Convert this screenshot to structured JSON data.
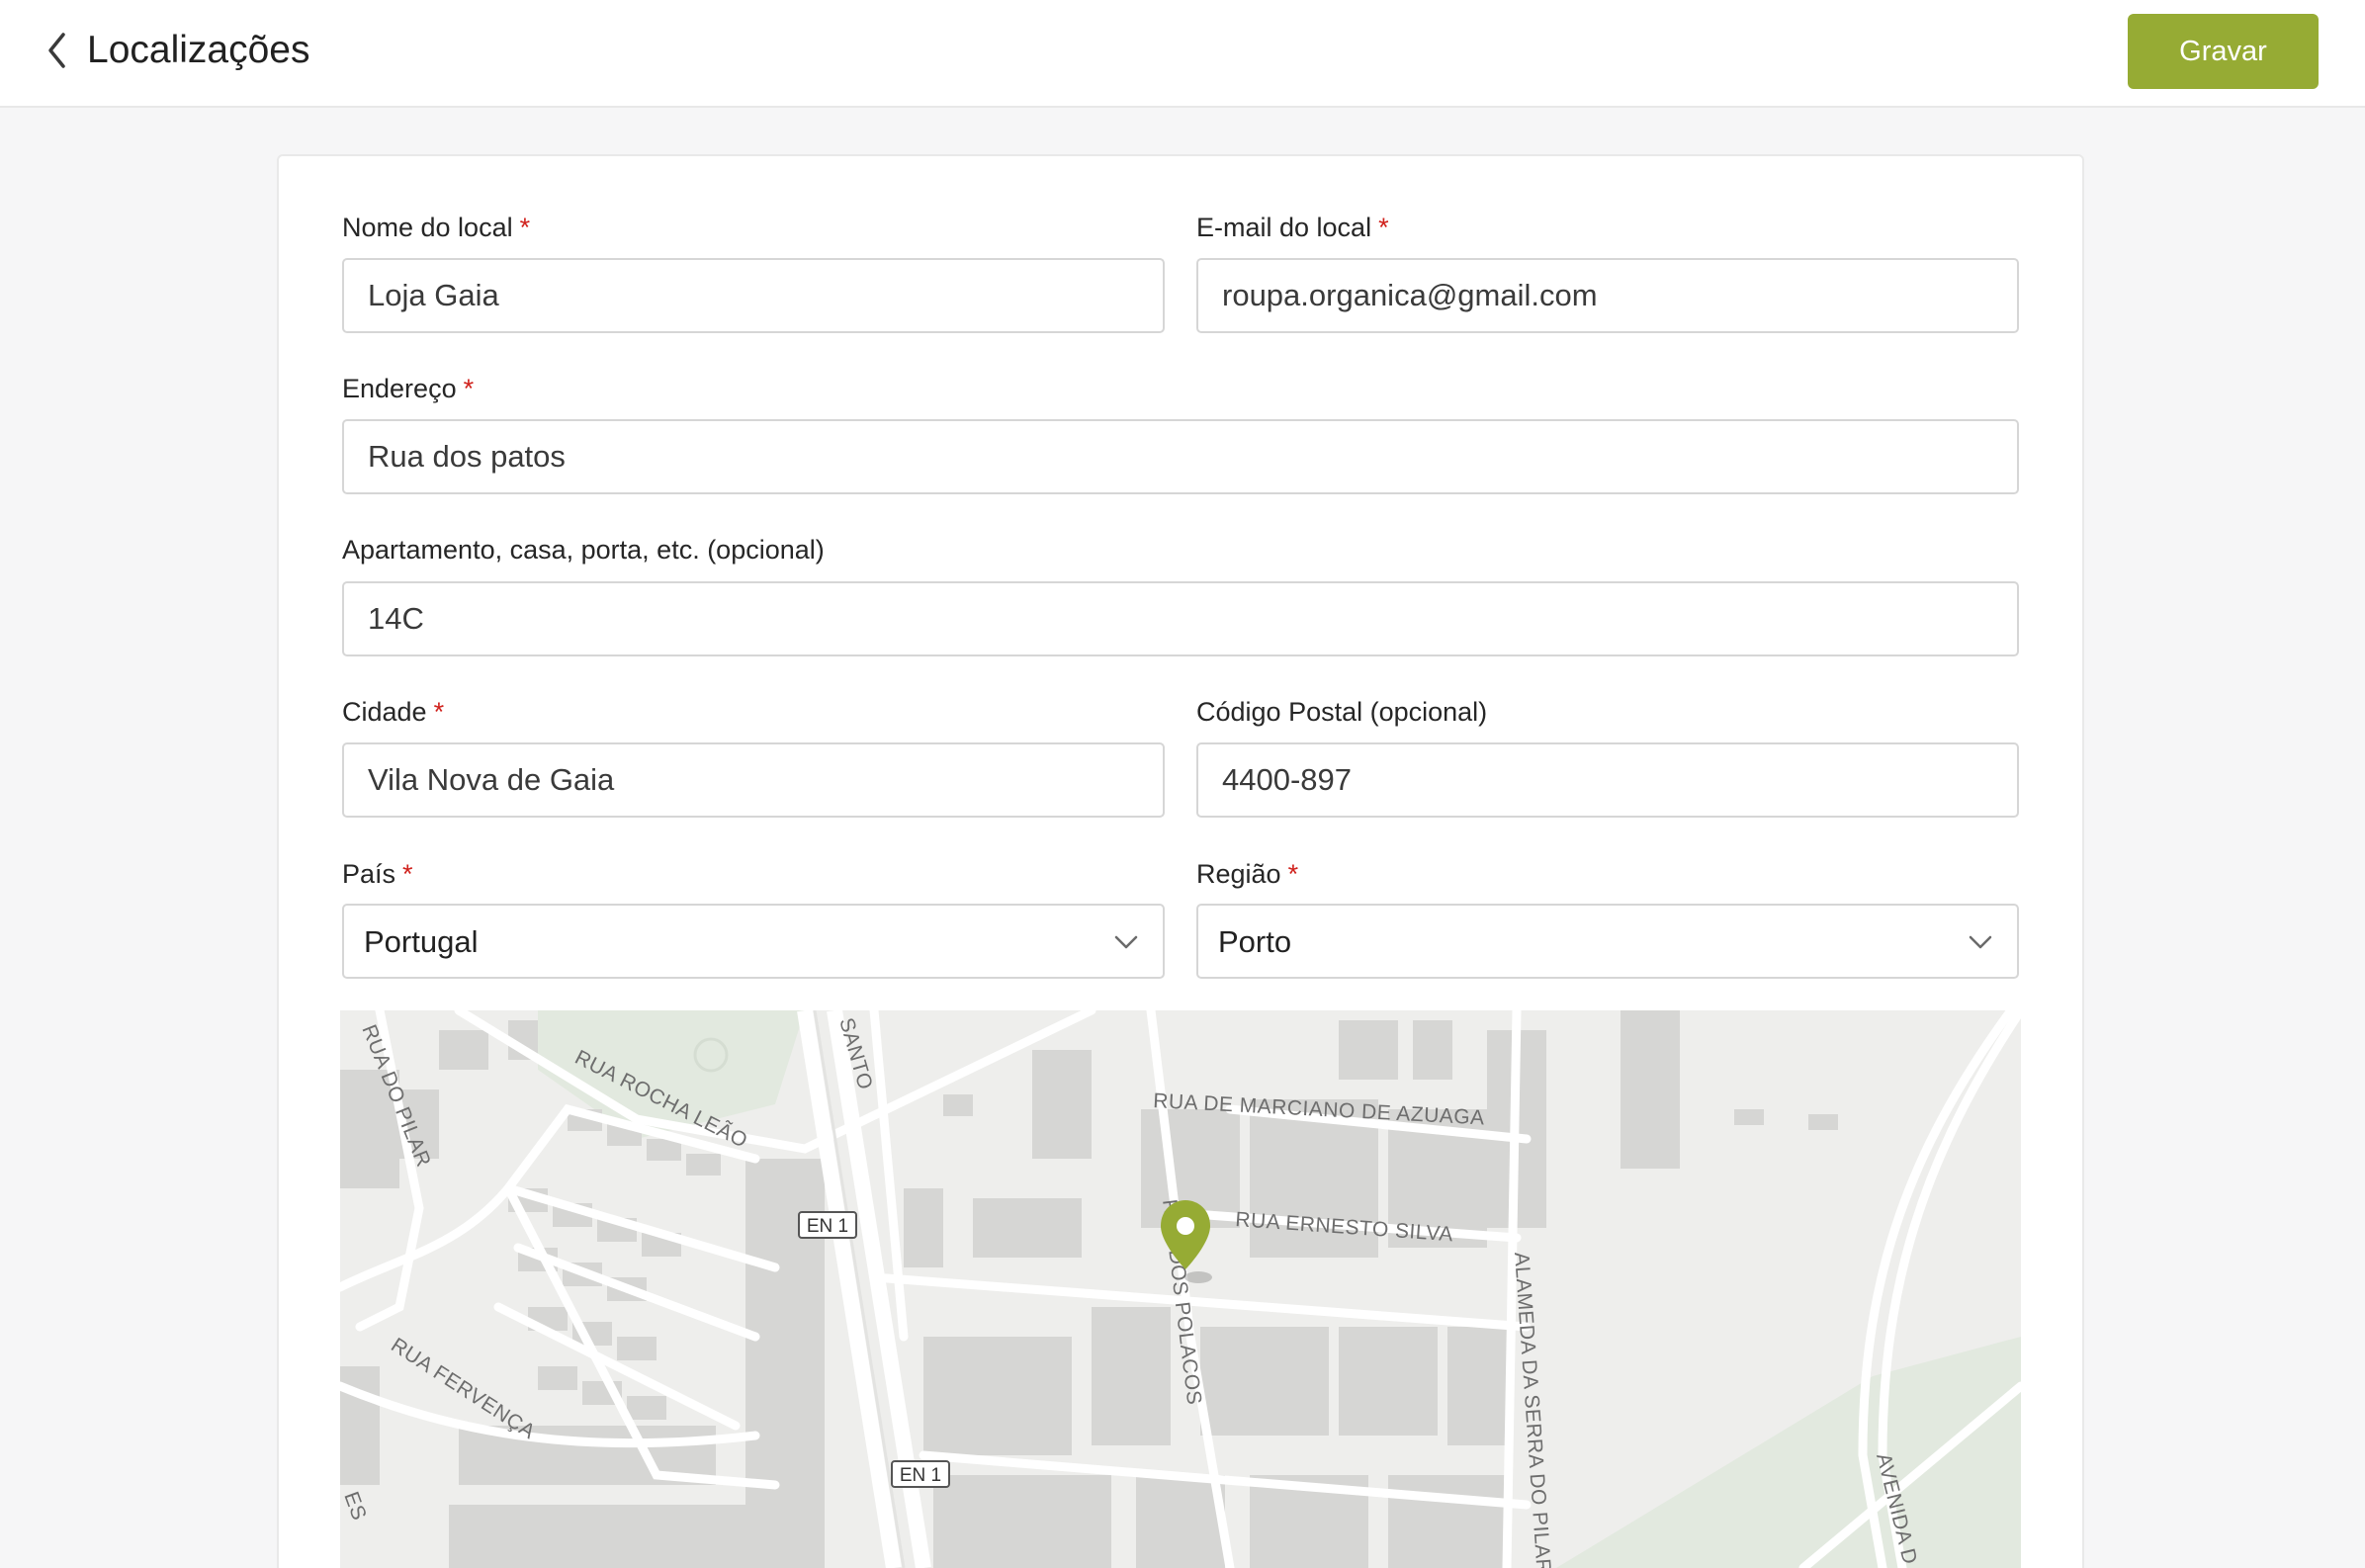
{
  "header": {
    "title": "Localizações",
    "save_label": "Gravar",
    "accent_color": "#96ab34"
  },
  "form": {
    "location_name": {
      "label": "Nome do local",
      "required_mark": "*",
      "value": "Loja Gaia"
    },
    "location_email": {
      "label": "E-mail do local",
      "required_mark": "*",
      "value": "roupa.organica@gmail.com"
    },
    "address": {
      "label": "Endereço",
      "required_mark": "*",
      "value": "Rua dos patos"
    },
    "apartment": {
      "label": "Apartamento, casa, porta, etc. (opcional)",
      "value": "14C"
    },
    "city": {
      "label": "Cidade",
      "required_mark": "*",
      "value": "Vila Nova de Gaia"
    },
    "postal_code": {
      "label": "Código Postal (opcional)",
      "value": "4400-897"
    },
    "country": {
      "label": "País",
      "required_mark": "*",
      "value": "Portugal"
    },
    "region": {
      "label": "Região",
      "required_mark": "*",
      "value": "Porto"
    }
  },
  "map": {
    "streets": {
      "rua_do_pilar": "RUA DO PILAR",
      "rua_rocha_leao": "RUA ROCHA LEÃO",
      "santo": "SANTO",
      "rua_marciano": "RUA DE MARCIANO DE AZUAGA",
      "rua_ernesto_silva": "RUA ERNESTO SILVA",
      "rua_polacos": "RUA DOS POLACOS",
      "alameda": "ALAMEDA DA SERRA DO PILAR",
      "rua_fervenca": "RUA FERVENÇA",
      "avenida": "AVENIDA D",
      "es": "ES"
    },
    "road_shield": "EN 1",
    "marker_color": "#96ab34",
    "marker_icon": "map-pin-icon"
  }
}
